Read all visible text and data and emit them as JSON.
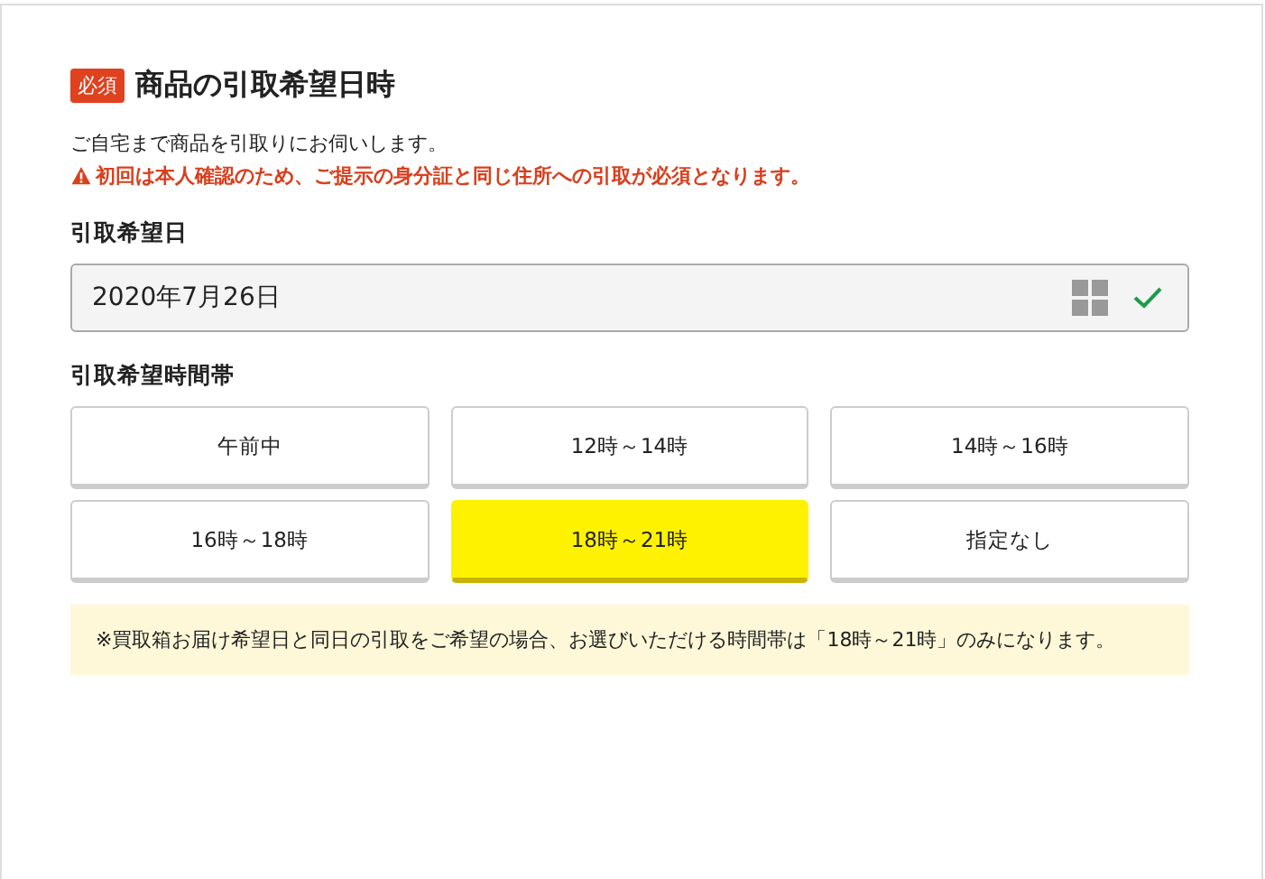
{
  "section": {
    "required_badge": "必須",
    "title": "商品の引取希望日時",
    "description": "ご自宅まで商品を引取りにお伺いします。",
    "warning": "初回は本人確認のため、ご提示の身分証と同じ住所への引取が必須となります。"
  },
  "date_field": {
    "label": "引取希望日",
    "value": "2020年7月26日",
    "valid": true
  },
  "time_slots": {
    "label": "引取希望時間帯",
    "options": [
      {
        "label": "午前中",
        "selected": false
      },
      {
        "label": "12時～14時",
        "selected": false
      },
      {
        "label": "14時～16時",
        "selected": false
      },
      {
        "label": "16時～18時",
        "selected": false
      },
      {
        "label": "18時～21時",
        "selected": true
      },
      {
        "label": "指定なし",
        "selected": false
      }
    ]
  },
  "notice": "※買取箱お届け希望日と同日の引取をご希望の場合、お選びいただける時間帯は「18時～21時」のみになります。"
}
